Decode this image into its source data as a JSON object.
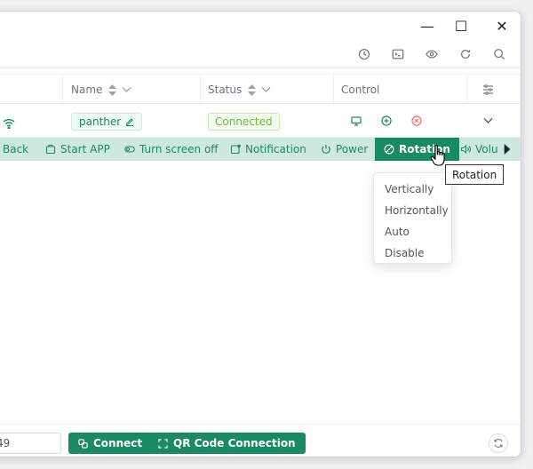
{
  "window": {
    "controls": {
      "minimize": "—",
      "maximize": "☐",
      "close": "✕"
    }
  },
  "toolbar": {
    "icons": [
      "clock-icon",
      "terminal-icon",
      "eye-icon",
      "refresh-icon",
      "search-icon"
    ]
  },
  "table": {
    "columns": {
      "name": "Name",
      "status": "Status",
      "control": "Control"
    },
    "row": {
      "name": "panther",
      "status": "Connected"
    }
  },
  "actions": {
    "back": "Back",
    "start_app": "Start APP",
    "turn_screen_off": "Turn screen off",
    "notification": "Notification",
    "power": "Power",
    "rotation": "Rotation",
    "volume": "Volu"
  },
  "tooltip": {
    "text": "Rotation"
  },
  "rotation_menu": {
    "items": [
      "Vertically",
      "Horizontally",
      "Auto",
      "Disable"
    ]
  },
  "footer": {
    "address_value": "49",
    "connect_label": "Connect",
    "qr_label": "QR Code Connection"
  },
  "colors": {
    "accent": "#198a64",
    "accent_light": "#cfe8df",
    "success": "#67c23a",
    "danger": "#f56c6c"
  }
}
